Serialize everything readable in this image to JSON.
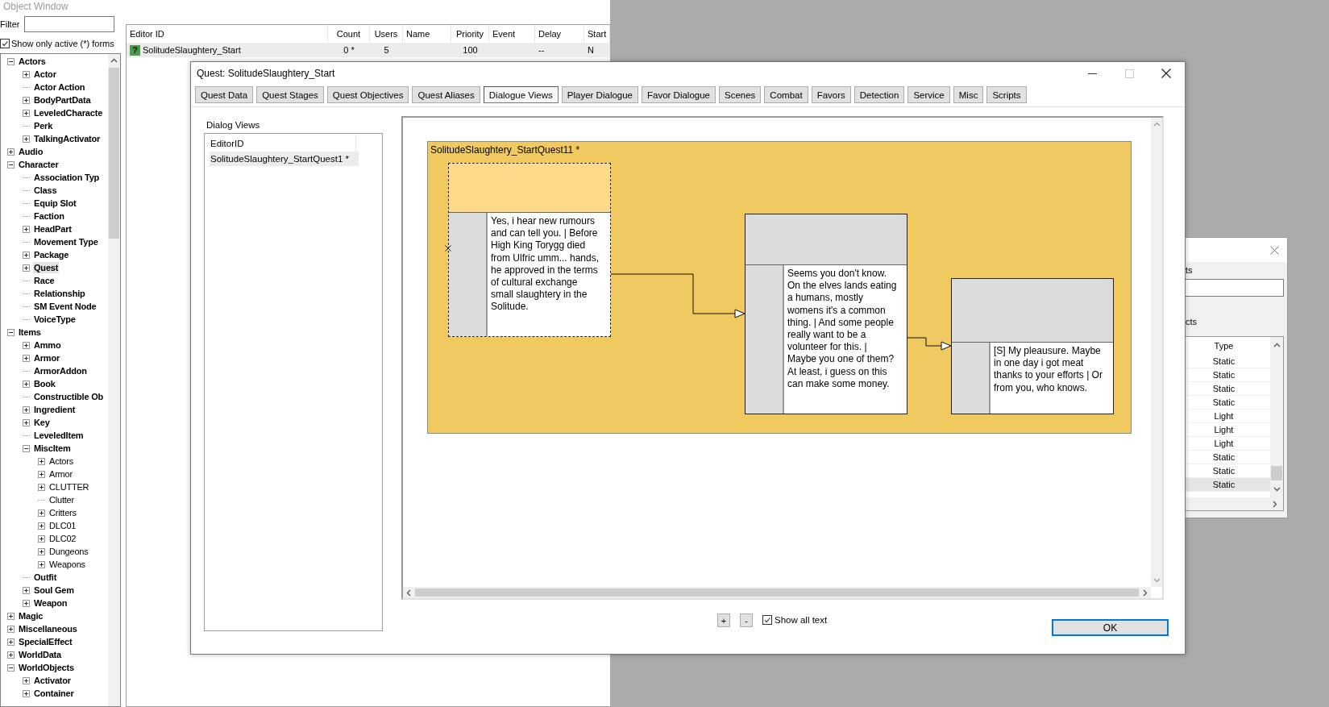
{
  "object_window": {
    "title": "Object Window",
    "filter": {
      "label": "Filter"
    },
    "active_only": {
      "label": "Show only active (*) forms",
      "checked": true
    },
    "tree": [
      {
        "label": "Actors",
        "expanded": true,
        "selected": false,
        "children": [
          {
            "label": "Actor",
            "expanded": false,
            "selected": false
          },
          {
            "label": "Actor Action",
            "selected": false
          },
          {
            "label": "BodyPartData",
            "expanded": false,
            "selected": false
          },
          {
            "label": "LeveledCharacte",
            "expanded": false,
            "selected": false
          },
          {
            "label": "Perk",
            "selected": false
          },
          {
            "label": "TalkingActivator",
            "expanded": false,
            "selected": false
          }
        ]
      },
      {
        "label": "Audio",
        "expanded": false,
        "selected": false
      },
      {
        "label": "Character",
        "expanded": true,
        "selected": false,
        "children": [
          {
            "label": "Association Typ",
            "selected": false
          },
          {
            "label": "Class",
            "selected": false
          },
          {
            "label": "Equip Slot",
            "selected": false
          },
          {
            "label": "Faction",
            "selected": false
          },
          {
            "label": "HeadPart",
            "expanded": false,
            "selected": false
          },
          {
            "label": "Movement Type",
            "selected": false
          },
          {
            "label": "Package",
            "expanded": false,
            "selected": false
          },
          {
            "label": "Quest",
            "expanded": false,
            "selected": true
          },
          {
            "label": "Race",
            "selected": false
          },
          {
            "label": "Relationship",
            "selected": false
          },
          {
            "label": "SM Event Node",
            "selected": false
          },
          {
            "label": "VoiceType",
            "selected": false
          }
        ]
      },
      {
        "label": "Items",
        "expanded": true,
        "selected": false,
        "children": [
          {
            "label": "Ammo",
            "expanded": false,
            "selected": false
          },
          {
            "label": "Armor",
            "expanded": false,
            "selected": false
          },
          {
            "label": "ArmorAddon",
            "selected": false
          },
          {
            "label": "Book",
            "expanded": false,
            "selected": false
          },
          {
            "label": "Constructible Ob",
            "selected": false
          },
          {
            "label": "Ingredient",
            "expanded": false,
            "selected": false
          },
          {
            "label": "Key",
            "expanded": false,
            "selected": false
          },
          {
            "label": "LeveledItem",
            "selected": false
          },
          {
            "label": "MiscItem",
            "expanded": true,
            "selected": false,
            "children": [
              {
                "label": "Actors",
                "expanded": false,
                "selected": false
              },
              {
                "label": "Armor",
                "expanded": false,
                "selected": false
              },
              {
                "label": "CLUTTER",
                "expanded": false,
                "selected": false
              },
              {
                "label": "Clutter",
                "selected": false
              },
              {
                "label": "Critters",
                "expanded": false,
                "selected": false
              },
              {
                "label": "DLC01",
                "expanded": false,
                "selected": false
              },
              {
                "label": "DLC02",
                "expanded": false,
                "selected": false
              },
              {
                "label": "Dungeons",
                "expanded": false,
                "selected": false
              },
              {
                "label": "Weapons",
                "expanded": false,
                "selected": false
              }
            ]
          },
          {
            "label": "Outfit",
            "selected": false
          },
          {
            "label": "Soul Gem",
            "expanded": false,
            "selected": false
          },
          {
            "label": "Weapon",
            "expanded": false,
            "selected": false
          }
        ]
      },
      {
        "label": "Magic",
        "expanded": false,
        "selected": false
      },
      {
        "label": "Miscellaneous",
        "expanded": false,
        "selected": false
      },
      {
        "label": "SpecialEffect",
        "expanded": false,
        "selected": false
      },
      {
        "label": "WorldData",
        "expanded": false,
        "selected": false
      },
      {
        "label": "WorldObjects",
        "expanded": true,
        "selected": false,
        "children": [
          {
            "label": "Activator",
            "expanded": false,
            "selected": false
          },
          {
            "label": "Container",
            "expanded": false,
            "selected": false
          }
        ]
      }
    ],
    "list": {
      "columns": [
        "Editor ID",
        "Count",
        "Users",
        "Name",
        "Priority",
        "Event",
        "Delay",
        "Start"
      ],
      "rows": [
        {
          "status": "?",
          "editor_id": "SolitudeSlaughtery_Start",
          "count": "0 *",
          "users": "5",
          "priority": "100",
          "delay": "--",
          "start": "N",
          "selected": true
        }
      ]
    }
  },
  "objects_window": {
    "label_1": "ts",
    "label_2": "cts",
    "columns": [
      "Type"
    ],
    "rows": [
      {
        "type": "Static",
        "selected": false
      },
      {
        "type": "Static",
        "selected": false
      },
      {
        "type": "Static",
        "selected": false
      },
      {
        "type": "Static",
        "selected": false
      },
      {
        "type": "Light",
        "selected": false
      },
      {
        "type": "Light",
        "selected": false
      },
      {
        "type": "Light",
        "selected": false
      },
      {
        "type": "Static",
        "selected": false
      },
      {
        "type": "Static",
        "selected": false
      },
      {
        "type": "Static",
        "selected": true
      }
    ]
  },
  "quest_window": {
    "title": "Quest: SolitudeSlaughtery_Start",
    "tabs": [
      {
        "label": "Quest Data",
        "selected": false
      },
      {
        "label": "Quest Stages",
        "selected": false
      },
      {
        "label": "Quest Objectives",
        "selected": false
      },
      {
        "label": "Quest Aliases",
        "selected": false
      },
      {
        "label": "Dialogue Views",
        "selected": true
      },
      {
        "label": "Player Dialogue",
        "selected": false
      },
      {
        "label": "Favor Dialogue",
        "selected": false
      },
      {
        "label": "Scenes",
        "selected": false
      },
      {
        "label": "Combat",
        "selected": false
      },
      {
        "label": "Favors",
        "selected": false
      },
      {
        "label": "Detection",
        "selected": false
      },
      {
        "label": "Service",
        "selected": false
      },
      {
        "label": "Misc",
        "selected": false
      },
      {
        "label": "Scripts",
        "selected": false
      }
    ],
    "dialog_views": {
      "label": "Dialog Views",
      "column": "EditorID",
      "rows": [
        {
          "label": "SolitudeSlaughtery_StartQuest1 *",
          "selected": true
        }
      ]
    },
    "group": {
      "title": "SolitudeSlaughtery_StartQuest11 *",
      "nodes": [
        {
          "text": "Yes, i hear new rumours and can tell you.  | Before High King Torygg died from Ulfric umm... hands, he approved in the terms of cultural exchange small slaughtery in the Solitude.",
          "selected": true,
          "start": true,
          "connects_to_next": true
        },
        {
          "text": "Seems you don't know. On the elves lands eating a humans, mostly womens it's a common thing. | And some people really want to be a volunteer for this. | Maybe you one of them? At least, i guess on this can make some money.",
          "selected": false,
          "start": false,
          "connects_to_next": true
        },
        {
          "text": "[S] My pleausure. Maybe in one day i got meat thanks to your efforts | Or from you, who knows.",
          "selected": false,
          "start": false
        }
      ]
    },
    "zoom_in": "+",
    "zoom_out": "-",
    "show_all_text": {
      "label": "Show all text",
      "checked": true
    },
    "ok": "OK"
  }
}
